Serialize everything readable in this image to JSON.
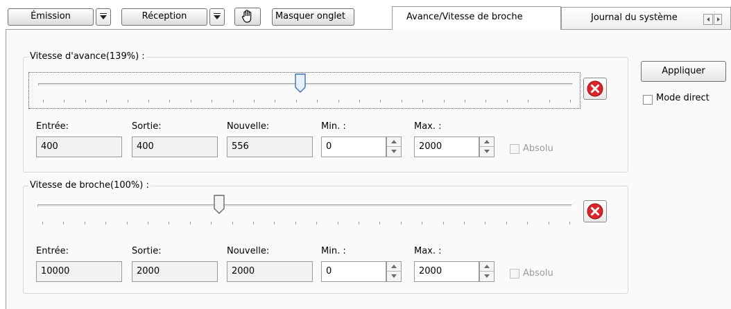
{
  "toolbar": {
    "emission_label": "Émission",
    "reception_label": "Réception",
    "masquer_label": "Masquer onglet"
  },
  "tabs": [
    {
      "label": "Avance/Vitesse de broche",
      "active": true
    },
    {
      "label": "Journal du système",
      "active": false
    }
  ],
  "feed": {
    "title": "Vitesse d'avance(139%) :",
    "percent": 139,
    "slider_fraction": 0.49,
    "labels": {
      "entree": "Entrée:",
      "sortie": "Sortie:",
      "nouvelle": "Nouvelle:",
      "min": "Min. :",
      "max": "Max. :"
    },
    "values": {
      "entree": "400",
      "sortie": "400",
      "nouvelle": "556",
      "min": "0",
      "max": "2000"
    },
    "absolu_label": "Absolu",
    "absolu_checked": false
  },
  "spindle": {
    "title": "Vitesse de broche(100%) :",
    "percent": 100,
    "slider_fraction": 0.34,
    "labels": {
      "entree": "Entrée:",
      "sortie": "Sortie:",
      "nouvelle": "Nouvelle:",
      "min": "Min. :",
      "max": "Max. :"
    },
    "values": {
      "entree": "10000",
      "sortie": "2000",
      "nouvelle": "2000",
      "min": "0",
      "max": "2000"
    },
    "absolu_label": "Absolu",
    "absolu_checked": false
  },
  "side": {
    "apply_label": "Appliquer",
    "mode_direct_label": "Mode direct",
    "mode_direct_checked": false
  },
  "colors": {
    "thumb_blue": "#3f6fb0",
    "close_red": "#d9262c"
  }
}
